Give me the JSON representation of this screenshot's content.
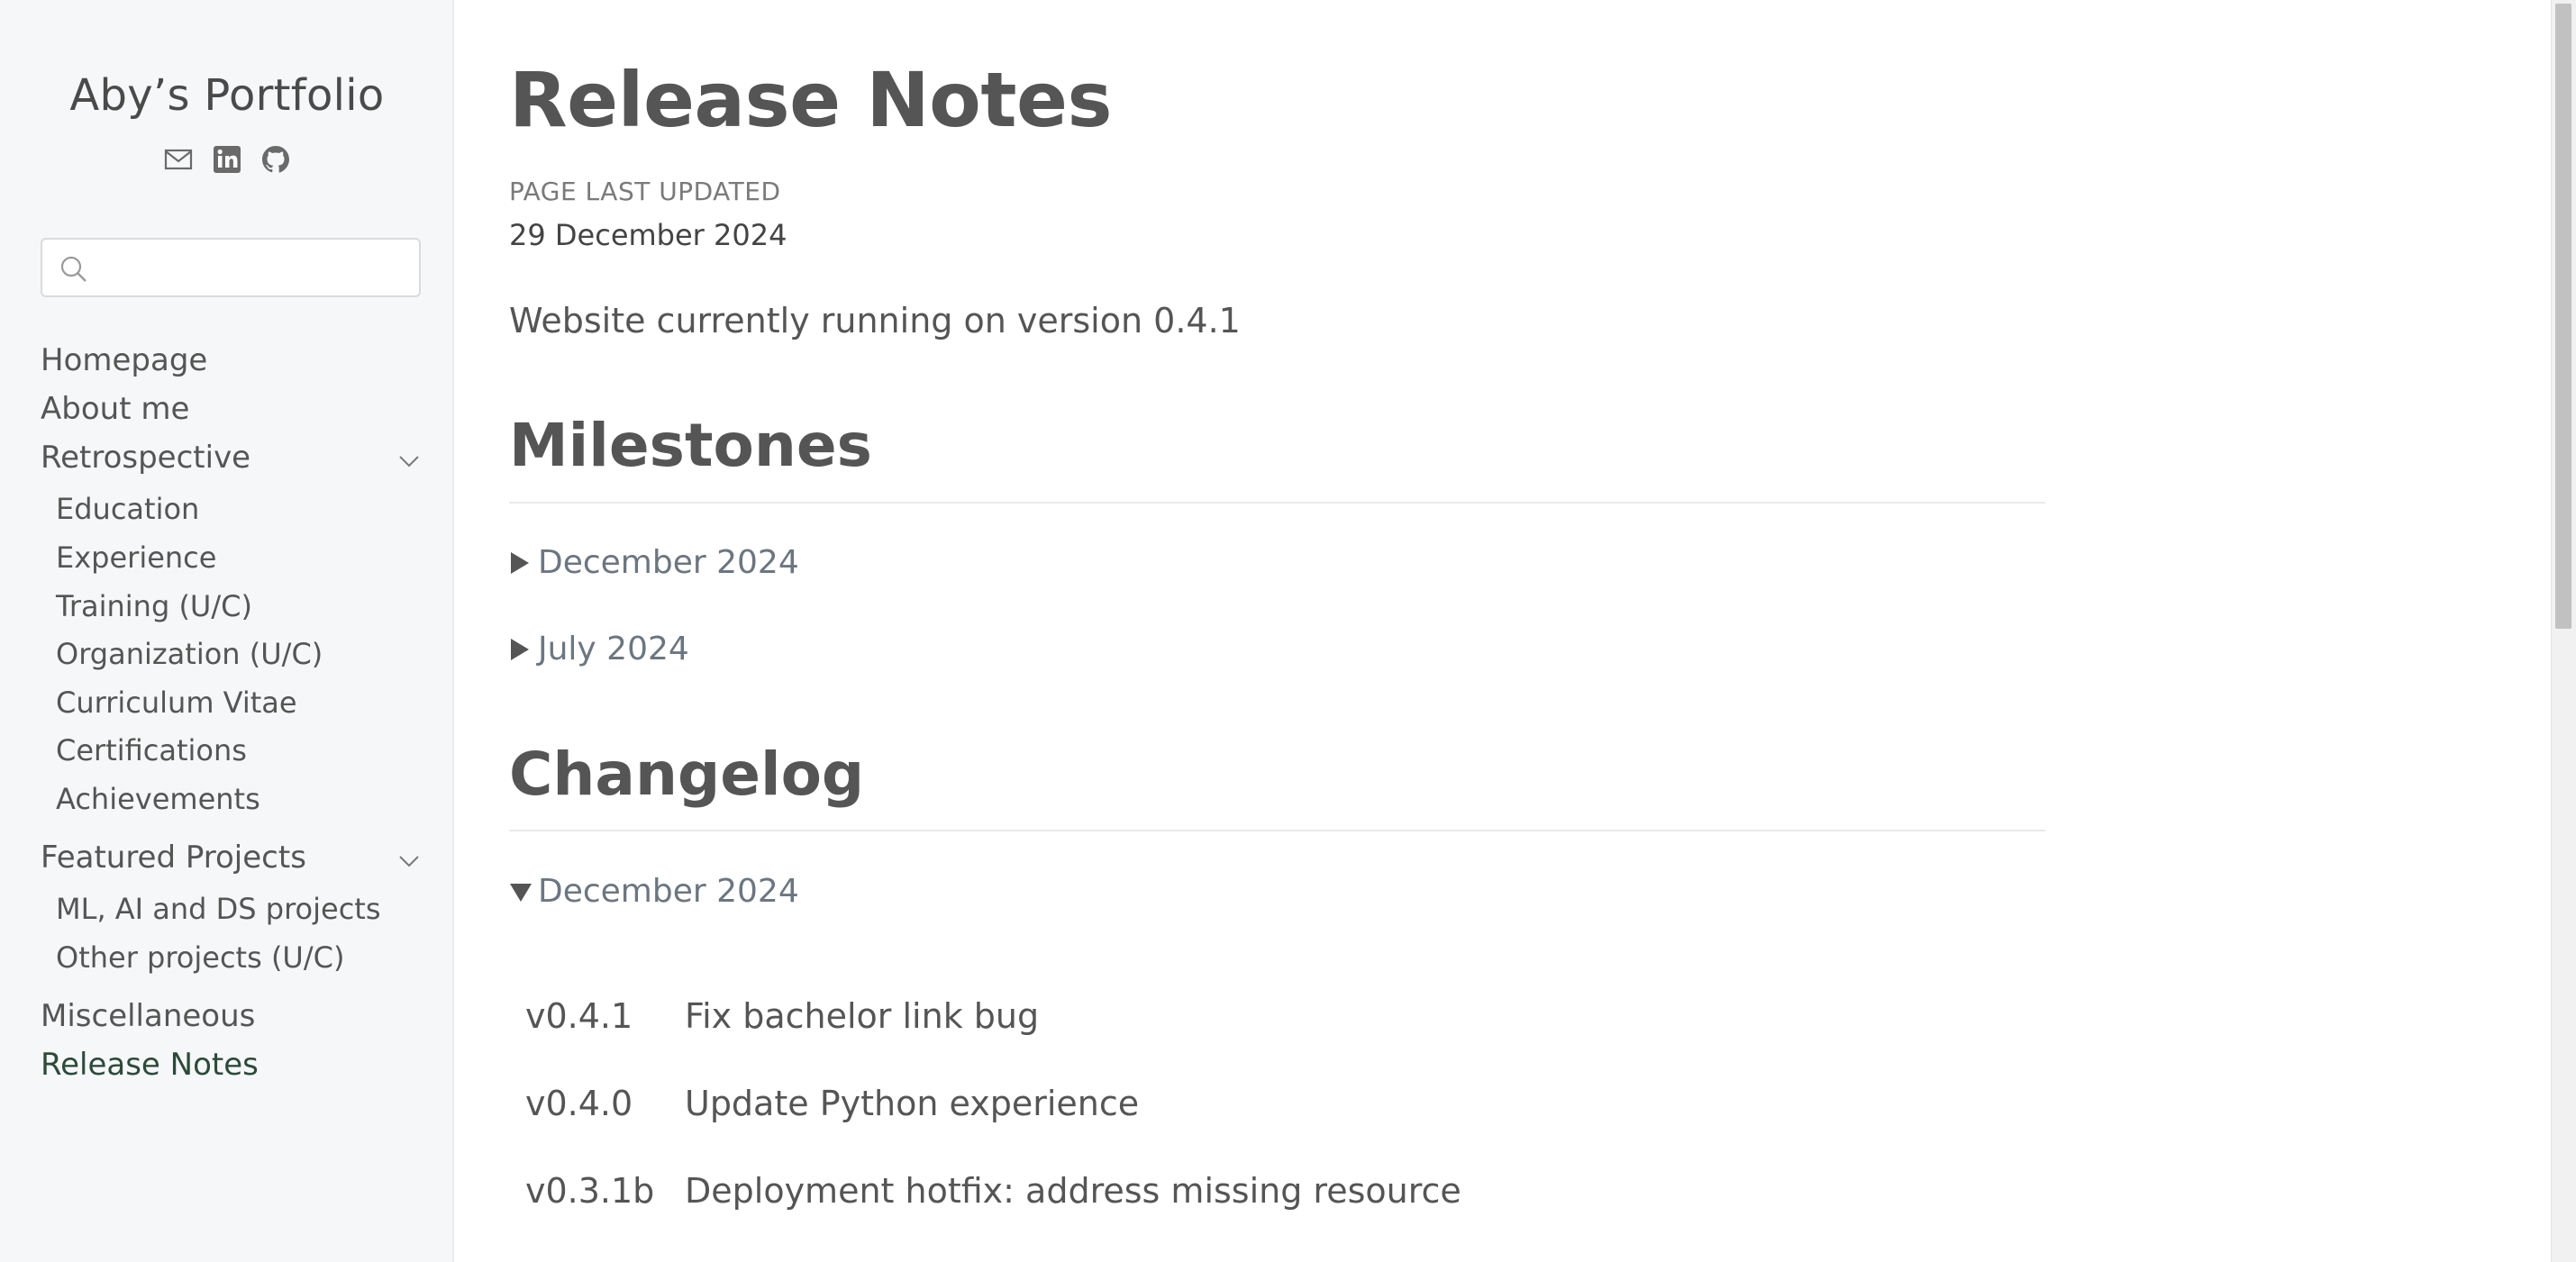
{
  "sidebar": {
    "site_title": "Aby’s Portfolio",
    "social_icons": [
      "mail-icon",
      "linkedin-icon",
      "github-icon"
    ],
    "search": {
      "placeholder": "",
      "value": ""
    },
    "nav": {
      "homepage": "Homepage",
      "about": "About me",
      "retrospective": "Retrospective",
      "retrospective_items": [
        "Education",
        "Experience",
        "Training (U/C)",
        "Organization (U/C)",
        "Curriculum Vitae",
        "Certifications",
        "Achievements"
      ],
      "featured": "Featured Projects",
      "featured_items": [
        "ML, AI and DS projects",
        "Other projects (U/C)"
      ],
      "misc": "Miscellaneous",
      "release_notes": "Release Notes"
    }
  },
  "main": {
    "title": "Release Notes",
    "meta_label": "PAGE LAST UPDATED",
    "meta_date": "29 December 2024",
    "intro": "Website currently running on version 0.4.1",
    "milestones": {
      "heading": "Milestones",
      "items": [
        "December 2024",
        "July 2024"
      ]
    },
    "changelog": {
      "heading": "Changelog",
      "open_section": "December 2024",
      "entries": [
        {
          "version": "v0.4.1",
          "description": "Fix bachelor link bug"
        },
        {
          "version": "v0.4.0",
          "description": "Update Python experience"
        },
        {
          "version": "v0.3.1b",
          "description": "Deployment hotfix: address missing resource"
        }
      ]
    }
  },
  "colors": {
    "sidebar_bg": "#f6f7f8",
    "text": "#555555",
    "active_nav": "#2c4a3a",
    "summary_text": "#6c7680"
  }
}
